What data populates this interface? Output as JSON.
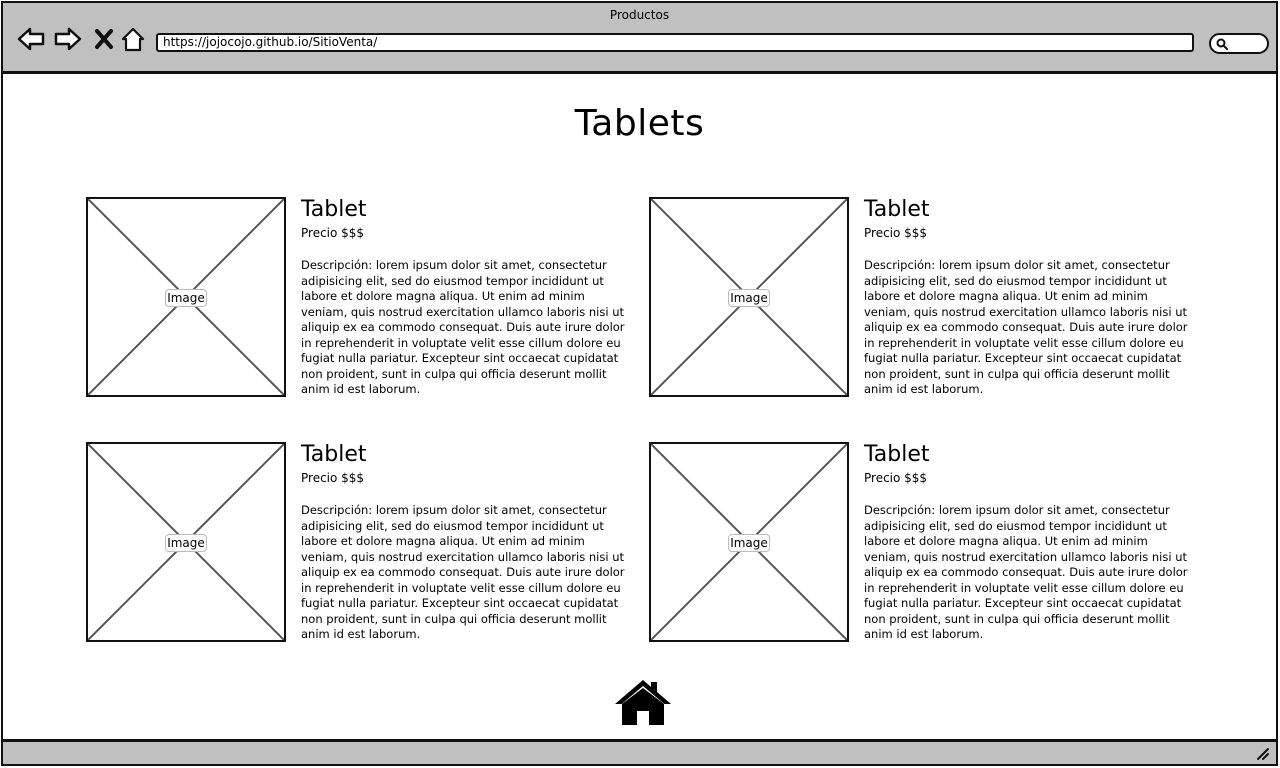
{
  "window": {
    "title": "Productos"
  },
  "toolbar": {
    "back_icon": "arrow-left-icon",
    "forward_icon": "arrow-right-icon",
    "stop_icon": "close-icon",
    "home_icon": "home-icon",
    "url": "https://jojocojo.github.io/SitioVenta/",
    "search_icon": "search-icon"
  },
  "page": {
    "title": "Tablets",
    "products": [
      {
        "image_label": "Image",
        "name": "Tablet",
        "price": "Precio $$$",
        "description": "Descripción: lorem ipsum dolor sit amet, consectetur adipisicing elit, sed do eiusmod tempor incididunt ut labore et dolore magna aliqua. Ut enim ad minim veniam, quis nostrud exercitation ullamco laboris nisi ut aliquip ex ea commodo consequat. Duis aute irure dolor in reprehenderit in voluptate velit esse cillum dolore eu fugiat nulla pariatur. Excepteur sint occaecat cupidatat non proident, sunt in culpa qui officia deserunt mollit anim id est laborum."
      },
      {
        "image_label": "Image",
        "name": "Tablet",
        "price": "Precio $$$",
        "description": "Descripción: lorem ipsum dolor sit amet, consectetur adipisicing elit, sed do eiusmod tempor incididunt ut labore et dolore magna aliqua. Ut enim ad minim veniam, quis nostrud exercitation ullamco laboris nisi ut aliquip ex ea commodo consequat. Duis aute irure dolor in reprehenderit in voluptate velit esse cillum dolore eu fugiat nulla pariatur. Excepteur sint occaecat cupidatat non proident, sunt in culpa qui officia deserunt mollit anim id est laborum."
      },
      {
        "image_label": "Image",
        "name": "Tablet",
        "price": "Precio $$$",
        "description": "Descripción: lorem ipsum dolor sit amet, consectetur adipisicing elit, sed do eiusmod tempor incididunt ut labore et dolore magna aliqua. Ut enim ad minim veniam, quis nostrud exercitation ullamco laboris nisi ut aliquip ex ea commodo consequat. Duis aute irure dolor in reprehenderit in voluptate velit esse cillum dolore eu fugiat nulla pariatur. Excepteur sint occaecat cupidatat non proident, sunt in culpa qui officia deserunt mollit anim id est laborum."
      },
      {
        "image_label": "Image",
        "name": "Tablet",
        "price": "Precio $$$",
        "description": "Descripción: lorem ipsum dolor sit amet, consectetur adipisicing elit, sed do eiusmod tempor incididunt ut labore et dolore magna aliqua. Ut enim ad minim veniam, quis nostrud exercitation ullamco laboris nisi ut aliquip ex ea commodo consequat. Duis aute irure dolor in reprehenderit in voluptate velit esse cillum dolore eu fugiat nulla pariatur. Excepteur sint occaecat cupidatat non proident, sunt in culpa qui officia deserunt mollit anim id est laborum."
      }
    ],
    "home_link_icon": "home-icon"
  },
  "colors": {
    "chrome": "#c0c0c0",
    "border": "#111111",
    "placeholder_line": "#555555"
  }
}
